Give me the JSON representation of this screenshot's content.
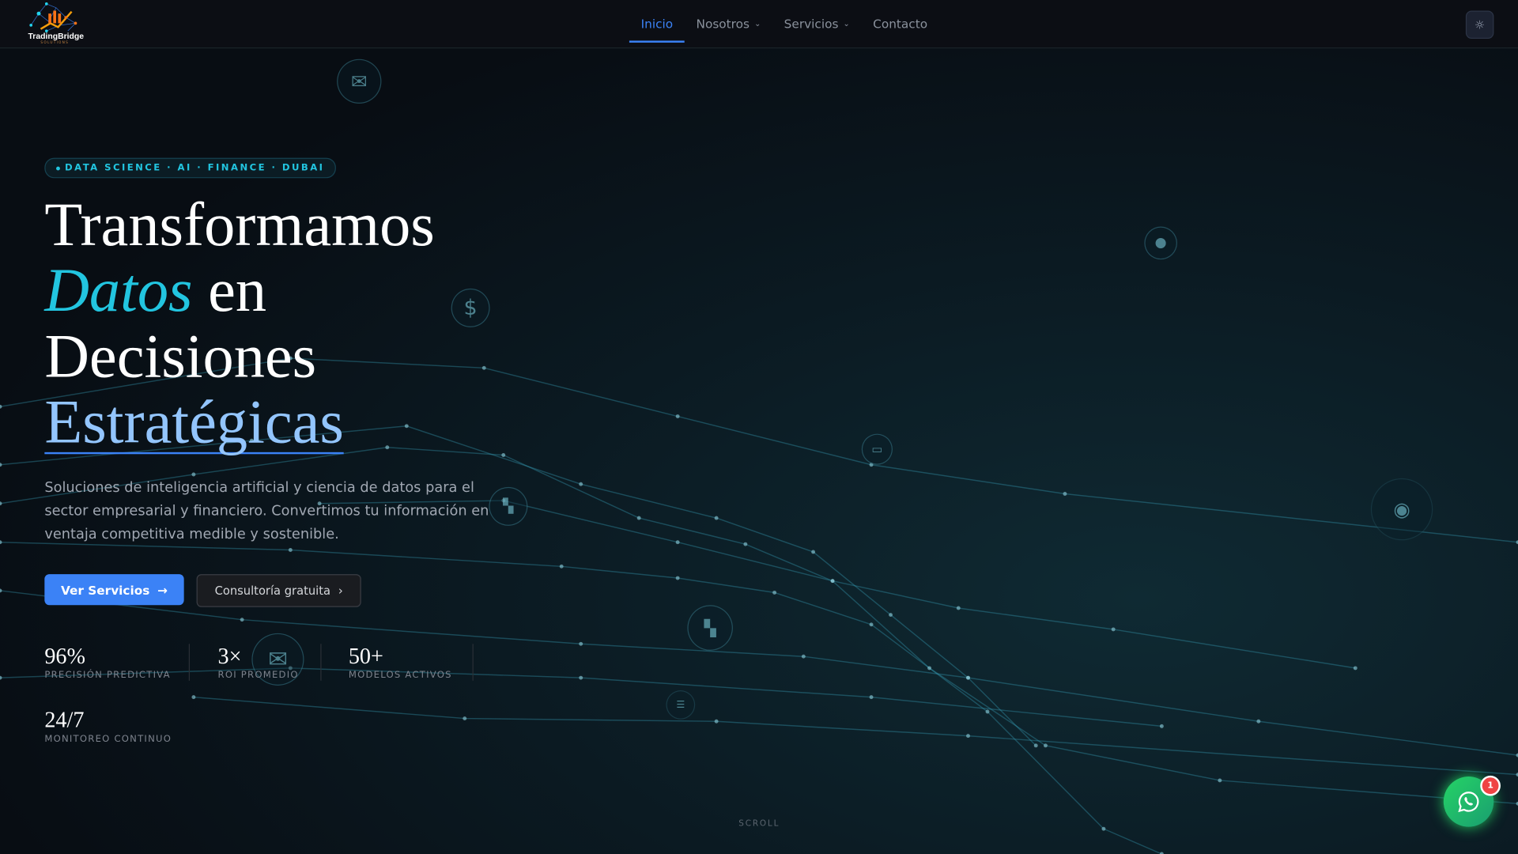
{
  "brand": {
    "name": "TradingBridge",
    "tagline": "SOLUTIONS"
  },
  "nav": {
    "items": [
      {
        "label": "Inicio",
        "active": true
      },
      {
        "label": "Nosotros",
        "dropdown": true
      },
      {
        "label": "Servicios",
        "dropdown": true
      },
      {
        "label": "Contacto"
      }
    ],
    "theme_icon": "sun-icon"
  },
  "hero": {
    "badge": "DATA SCIENCE · AI · FINANCE · DUBAI",
    "title_1": "Transformamos",
    "title_2_accent": "Datos",
    "title_2_rest": " en",
    "title_3": "Decisiones",
    "title_4_accent": "Estratégicas",
    "lead": "Soluciones de inteligencia artificial y ciencia de datos para el sector empresarial y financiero. Convertimos tu información en ventaja competitiva medible y sostenible.",
    "primary_button": "Ver Servicios",
    "secondary_button": "Consultoría gratuita"
  },
  "stats": [
    {
      "value": "96%",
      "label": "PRECISIÓN PREDICTIVA"
    },
    {
      "value": "3×",
      "label": "ROI PROMEDIO"
    },
    {
      "value": "50+",
      "label": "MODELOS ACTIVOS"
    },
    {
      "value": "24/7",
      "label": "MONITOREO CONTINUO"
    }
  ],
  "scroll_label": "SCROLL",
  "whatsapp": {
    "badge_count": "1"
  },
  "colors": {
    "accent": "#3b82f6",
    "cyan": "#22c5e0",
    "whatsapp": "#25d366"
  }
}
